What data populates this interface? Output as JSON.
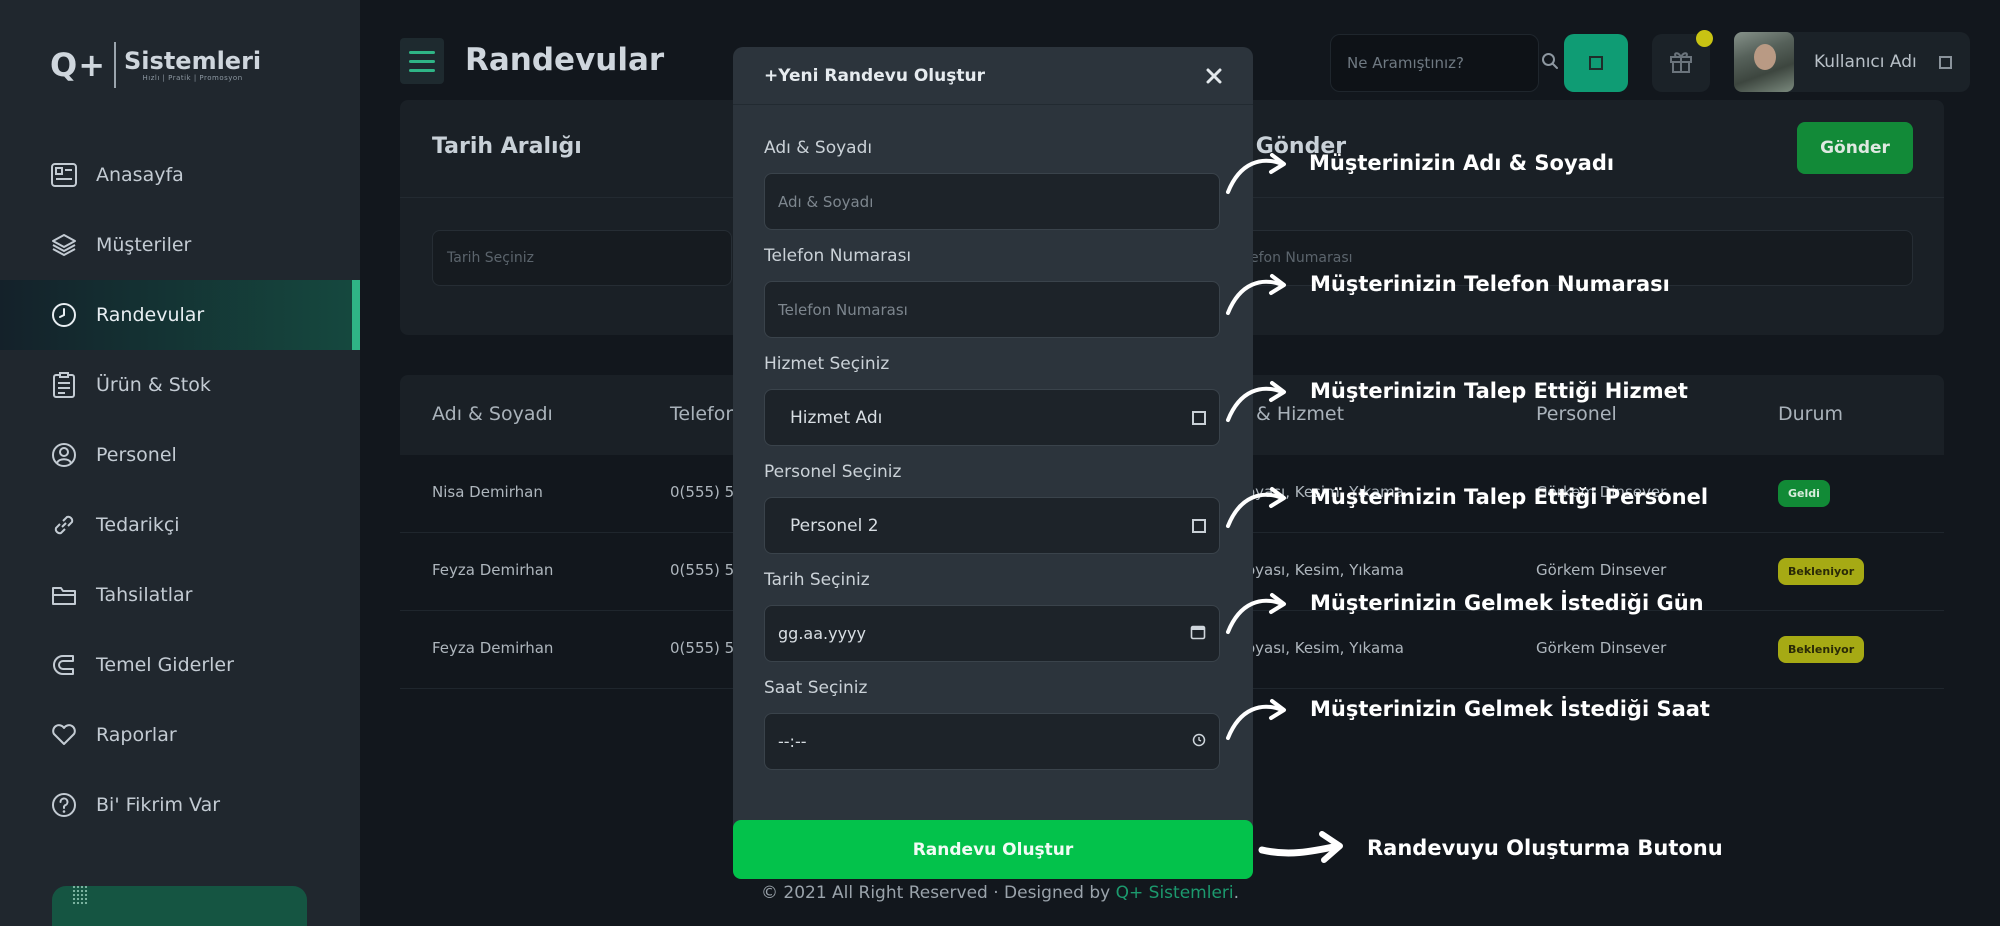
{
  "sidebar": {
    "logo": {
      "mark": "Q+",
      "name": "Sistemleri",
      "tagline": "Hızlı | Pratik | Promosyon"
    },
    "items": [
      {
        "label": "Anasayfa",
        "icon": "dashboard-icon"
      },
      {
        "label": "Müşteriler",
        "icon": "layers-icon"
      },
      {
        "label": "Randevular",
        "icon": "clock-icon",
        "active": true
      },
      {
        "label": "Ürün & Stok",
        "icon": "clipboard-icon"
      },
      {
        "label": "Personel",
        "icon": "user-circle-icon"
      },
      {
        "label": "Tedarikçi",
        "icon": "link-icon"
      },
      {
        "label": "Tahsilatlar",
        "icon": "folder-icon"
      },
      {
        "label": "Temel Giderler",
        "icon": "magnet-icon"
      },
      {
        "label": "Raporlar",
        "icon": "heart-icon"
      },
      {
        "label": "Bi' Fikrim Var",
        "icon": "question-icon"
      }
    ]
  },
  "header": {
    "title": "Randevular",
    "search_placeholder": "Ne Aramıştınız?",
    "user_name": "Kullanıcı Adı"
  },
  "filter": {
    "title": "Tarih Aralığı",
    "sms_title": "s Gönder",
    "send_label": "Gönder",
    "date_placeholder": "Tarih Seçiniz",
    "phone_placeholder": "efon Numarası"
  },
  "table": {
    "columns": [
      "Adı & Soyadı",
      "Telefon",
      "& Hizmet",
      "Personel",
      "Durum"
    ],
    "rows": [
      {
        "name": "Nisa Demirhan",
        "phone": "0(555) 5",
        "service": "oyası, Kesim, Yıkama",
        "staff": "Görkem Dinsever",
        "status": "Geldi"
      },
      {
        "name": "Feyza Demirhan",
        "phone": "0(555) 5",
        "service": "oyası, Kesim, Yıkama",
        "staff": "Görkem Dinsever",
        "status": "Bekleniyor"
      },
      {
        "name": "Feyza Demirhan",
        "phone": "0(555) 5",
        "service": "oyası, Kesim, Yıkama",
        "staff": "Görkem Dinsever",
        "status": "Bekleniyor"
      }
    ]
  },
  "modal": {
    "title": "+Yeni Randevu Oluştur",
    "fields": {
      "name": {
        "label": "Adı & Soyadı",
        "placeholder": "Adı & Soyadı"
      },
      "phone": {
        "label": "Telefon Numarası",
        "placeholder": "Telefon Numarası"
      },
      "service": {
        "label": "Hizmet Seçiniz",
        "value": "Hizmet Adı"
      },
      "staff": {
        "label": "Personel Seçiniz",
        "value": "Personel 2"
      },
      "date": {
        "label": "Tarih Seçiniz",
        "value": "gg.aa.yyyy"
      },
      "time": {
        "label": "Saat Seçiniz",
        "value": "--:--"
      }
    },
    "submit_label": "Randevu Oluştur"
  },
  "annotations": {
    "name": "Müşterinizin Adı & Soyadı",
    "phone": "Müşterinizin Telefon Numarası",
    "service": "Müşterinizin Talep Ettiği Hizmet",
    "staff": "Müşterinizin Talep Ettiği Personel",
    "date": "Müşterinizin Gelmek İstediği Gün",
    "time": "Müşterinizin Gelmek İstediği Saat",
    "submit": "Randevuyu Oluşturma Butonu"
  },
  "footer": {
    "prefix": "© 2021 All Right Reserved · Designed by ",
    "brand": "Q+ Sistemleri",
    "suffix": "."
  },
  "colors": {
    "accent": "#2fb586",
    "primary_button": "#03c24b",
    "send_button": "#128a38",
    "badge_arrived": "#118a36",
    "badge_waiting": "#a6aa14"
  }
}
